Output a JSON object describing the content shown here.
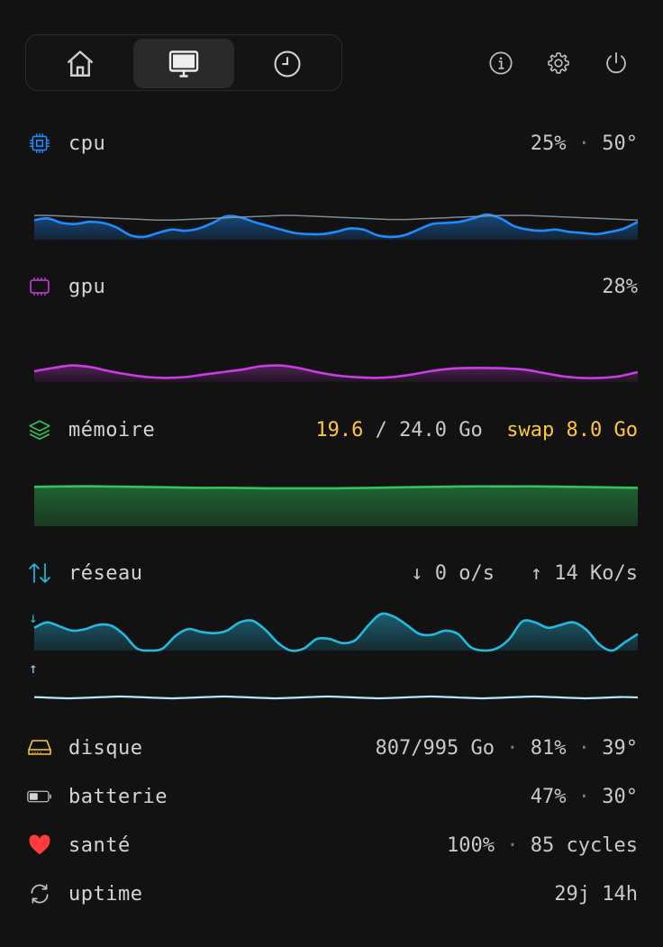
{
  "tabs": [
    {
      "name": "home",
      "icon": "home-icon",
      "active": false
    },
    {
      "name": "monitor",
      "icon": "monitor-icon",
      "active": true
    },
    {
      "name": "history",
      "icon": "clock-icon",
      "active": false
    }
  ],
  "top_actions": [
    "info-icon",
    "gear-icon",
    "power-icon"
  ],
  "colors": {
    "cpu": "#1e8cff",
    "gpu": "#c93ee0",
    "memory": "#32c45a",
    "network": "#26b9e0",
    "highlight": "#ffc53d",
    "heart": "#ff3b3b"
  },
  "cpu": {
    "label": "cpu",
    "usage": "25%",
    "sep": "·",
    "temp": "50°"
  },
  "gpu": {
    "label": "gpu",
    "usage": "28%"
  },
  "memory": {
    "label": "mémoire",
    "used": "19.6",
    "slash": "/",
    "total": "24.0 Go",
    "swap_label": "swap",
    "swap_value": "8.0 Go"
  },
  "network": {
    "label": "réseau",
    "down_arrow": "↓",
    "down": "0 o/s",
    "up_arrow": "↑",
    "up": "14 Ko/s"
  },
  "disk": {
    "label": "disque",
    "usage": "807/995 Go",
    "percent": "81%",
    "temp": "39°"
  },
  "battery": {
    "label": "batterie",
    "percent": "47%",
    "temp": "30°",
    "level": 0.47
  },
  "health": {
    "label": "santé",
    "percent": "100%",
    "cycles": "85 cycles"
  },
  "uptime": {
    "label": "uptime",
    "value": "29j 14h"
  },
  "sep": "·",
  "chart_data": [
    {
      "type": "area",
      "name": "cpu",
      "ylim": [
        0,
        100
      ],
      "series": [
        {
          "name": "load",
          "values": [
            35,
            38,
            30,
            28,
            32,
            30,
            22,
            8,
            5,
            12,
            18,
            16,
            20,
            30,
            42,
            40,
            32,
            25,
            18,
            12,
            10,
            10,
            14,
            20,
            18,
            8,
            5,
            8,
            18,
            28,
            30,
            32,
            38,
            45,
            38,
            24,
            18,
            16,
            18,
            14,
            12,
            10,
            14,
            20,
            32
          ]
        },
        {
          "name": "temp",
          "values": [
            42,
            42,
            41,
            40,
            39,
            38,
            37,
            36,
            35,
            34,
            34,
            35,
            36,
            37,
            38,
            39,
            40,
            41,
            42,
            42,
            41,
            40,
            39,
            38,
            37,
            36,
            35,
            35,
            36,
            37,
            38,
            39,
            40,
            41,
            42,
            42,
            42,
            41,
            40,
            39,
            38,
            37,
            36,
            35,
            34
          ]
        }
      ]
    },
    {
      "type": "area",
      "name": "gpu",
      "ylim": [
        0,
        100
      ],
      "values": [
        26,
        34,
        40,
        36,
        26,
        18,
        12,
        10,
        12,
        18,
        24,
        30,
        38,
        40,
        34,
        24,
        16,
        12,
        10,
        12,
        18,
        26,
        32,
        34,
        34,
        33,
        30,
        22,
        14,
        10,
        10,
        14,
        24
      ]
    },
    {
      "type": "area",
      "name": "mémoire",
      "ylim": [
        0,
        100
      ],
      "values": [
        84,
        85,
        85,
        84,
        83,
        82,
        82,
        81,
        81,
        81,
        82,
        83,
        84,
        85,
        85,
        85,
        84,
        83,
        82
      ]
    },
    {
      "type": "area",
      "name": "réseau ↓",
      "ylim": [
        0,
        100
      ],
      "values": [
        55,
        68,
        58,
        48,
        52,
        62,
        60,
        38,
        5,
        0,
        5,
        35,
        52,
        45,
        42,
        48,
        68,
        72,
        50,
        18,
        0,
        5,
        28,
        28,
        18,
        25,
        60,
        88,
        82,
        62,
        40,
        38,
        48,
        40,
        8,
        0,
        5,
        28,
        70,
        68,
        55,
        62,
        68,
        50,
        15,
        0,
        20,
        40
      ]
    },
    {
      "type": "line",
      "name": "réseau ↑",
      "ylim": [
        0,
        100
      ],
      "values": [
        52,
        48,
        45,
        48,
        52,
        55,
        52,
        48,
        45,
        48,
        52,
        55,
        52,
        48,
        45,
        48,
        52,
        55,
        52,
        48,
        45,
        48,
        52,
        55,
        52,
        48,
        45,
        48,
        52,
        55,
        52,
        48,
        45,
        48,
        52,
        50
      ]
    }
  ]
}
